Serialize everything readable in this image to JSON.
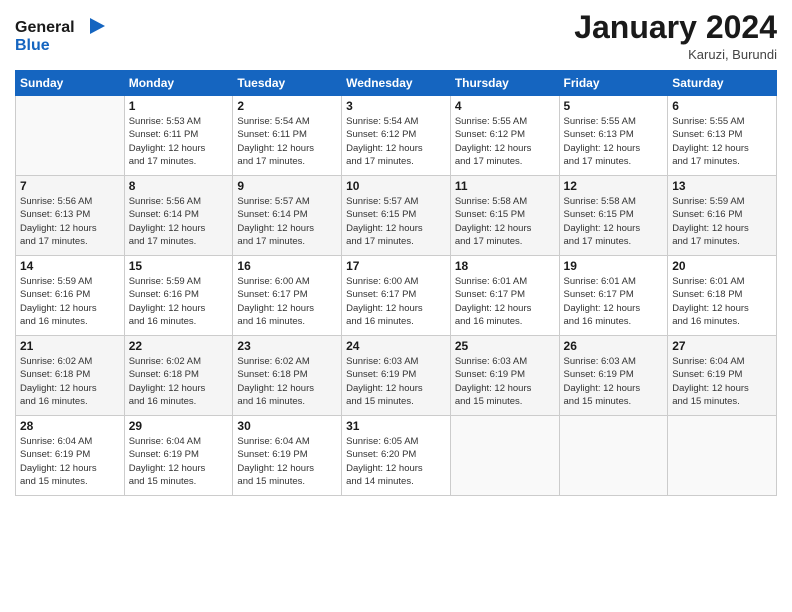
{
  "logo": {
    "line1": "General",
    "line2": "Blue"
  },
  "title": "January 2024",
  "subtitle": "Karuzi, Burundi",
  "days_of_week": [
    "Sunday",
    "Monday",
    "Tuesday",
    "Wednesday",
    "Thursday",
    "Friday",
    "Saturday"
  ],
  "weeks": [
    [
      {
        "day": "",
        "info": ""
      },
      {
        "day": "1",
        "info": "Sunrise: 5:53 AM\nSunset: 6:11 PM\nDaylight: 12 hours\nand 17 minutes."
      },
      {
        "day": "2",
        "info": "Sunrise: 5:54 AM\nSunset: 6:11 PM\nDaylight: 12 hours\nand 17 minutes."
      },
      {
        "day": "3",
        "info": "Sunrise: 5:54 AM\nSunset: 6:12 PM\nDaylight: 12 hours\nand 17 minutes."
      },
      {
        "day": "4",
        "info": "Sunrise: 5:55 AM\nSunset: 6:12 PM\nDaylight: 12 hours\nand 17 minutes."
      },
      {
        "day": "5",
        "info": "Sunrise: 5:55 AM\nSunset: 6:13 PM\nDaylight: 12 hours\nand 17 minutes."
      },
      {
        "day": "6",
        "info": "Sunrise: 5:55 AM\nSunset: 6:13 PM\nDaylight: 12 hours\nand 17 minutes."
      }
    ],
    [
      {
        "day": "7",
        "info": "Sunrise: 5:56 AM\nSunset: 6:13 PM\nDaylight: 12 hours\nand 17 minutes."
      },
      {
        "day": "8",
        "info": "Sunrise: 5:56 AM\nSunset: 6:14 PM\nDaylight: 12 hours\nand 17 minutes."
      },
      {
        "day": "9",
        "info": "Sunrise: 5:57 AM\nSunset: 6:14 PM\nDaylight: 12 hours\nand 17 minutes."
      },
      {
        "day": "10",
        "info": "Sunrise: 5:57 AM\nSunset: 6:15 PM\nDaylight: 12 hours\nand 17 minutes."
      },
      {
        "day": "11",
        "info": "Sunrise: 5:58 AM\nSunset: 6:15 PM\nDaylight: 12 hours\nand 17 minutes."
      },
      {
        "day": "12",
        "info": "Sunrise: 5:58 AM\nSunset: 6:15 PM\nDaylight: 12 hours\nand 17 minutes."
      },
      {
        "day": "13",
        "info": "Sunrise: 5:59 AM\nSunset: 6:16 PM\nDaylight: 12 hours\nand 17 minutes."
      }
    ],
    [
      {
        "day": "14",
        "info": "Sunrise: 5:59 AM\nSunset: 6:16 PM\nDaylight: 12 hours\nand 16 minutes."
      },
      {
        "day": "15",
        "info": "Sunrise: 5:59 AM\nSunset: 6:16 PM\nDaylight: 12 hours\nand 16 minutes."
      },
      {
        "day": "16",
        "info": "Sunrise: 6:00 AM\nSunset: 6:17 PM\nDaylight: 12 hours\nand 16 minutes."
      },
      {
        "day": "17",
        "info": "Sunrise: 6:00 AM\nSunset: 6:17 PM\nDaylight: 12 hours\nand 16 minutes."
      },
      {
        "day": "18",
        "info": "Sunrise: 6:01 AM\nSunset: 6:17 PM\nDaylight: 12 hours\nand 16 minutes."
      },
      {
        "day": "19",
        "info": "Sunrise: 6:01 AM\nSunset: 6:17 PM\nDaylight: 12 hours\nand 16 minutes."
      },
      {
        "day": "20",
        "info": "Sunrise: 6:01 AM\nSunset: 6:18 PM\nDaylight: 12 hours\nand 16 minutes."
      }
    ],
    [
      {
        "day": "21",
        "info": "Sunrise: 6:02 AM\nSunset: 6:18 PM\nDaylight: 12 hours\nand 16 minutes."
      },
      {
        "day": "22",
        "info": "Sunrise: 6:02 AM\nSunset: 6:18 PM\nDaylight: 12 hours\nand 16 minutes."
      },
      {
        "day": "23",
        "info": "Sunrise: 6:02 AM\nSunset: 6:18 PM\nDaylight: 12 hours\nand 16 minutes."
      },
      {
        "day": "24",
        "info": "Sunrise: 6:03 AM\nSunset: 6:19 PM\nDaylight: 12 hours\nand 15 minutes."
      },
      {
        "day": "25",
        "info": "Sunrise: 6:03 AM\nSunset: 6:19 PM\nDaylight: 12 hours\nand 15 minutes."
      },
      {
        "day": "26",
        "info": "Sunrise: 6:03 AM\nSunset: 6:19 PM\nDaylight: 12 hours\nand 15 minutes."
      },
      {
        "day": "27",
        "info": "Sunrise: 6:04 AM\nSunset: 6:19 PM\nDaylight: 12 hours\nand 15 minutes."
      }
    ],
    [
      {
        "day": "28",
        "info": "Sunrise: 6:04 AM\nSunset: 6:19 PM\nDaylight: 12 hours\nand 15 minutes."
      },
      {
        "day": "29",
        "info": "Sunrise: 6:04 AM\nSunset: 6:19 PM\nDaylight: 12 hours\nand 15 minutes."
      },
      {
        "day": "30",
        "info": "Sunrise: 6:04 AM\nSunset: 6:19 PM\nDaylight: 12 hours\nand 15 minutes."
      },
      {
        "day": "31",
        "info": "Sunrise: 6:05 AM\nSunset: 6:20 PM\nDaylight: 12 hours\nand 14 minutes."
      },
      {
        "day": "",
        "info": ""
      },
      {
        "day": "",
        "info": ""
      },
      {
        "day": "",
        "info": ""
      }
    ]
  ]
}
